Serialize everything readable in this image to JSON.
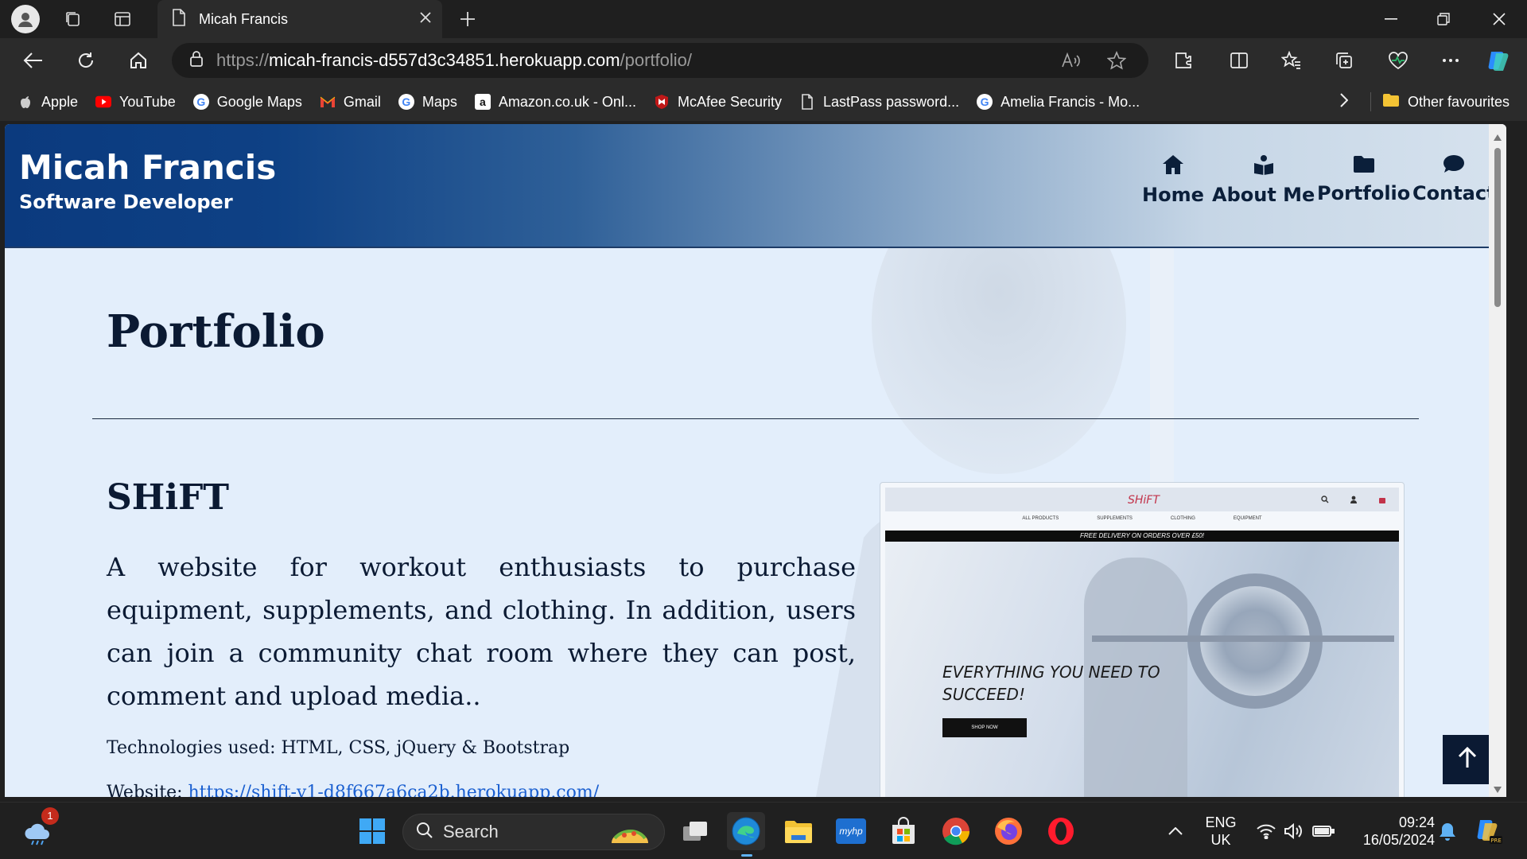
{
  "browser": {
    "tab_title": "Micah Francis",
    "url_prefix": "https://",
    "url_host": "micah-francis-d557d3c34851.herokuapp.com",
    "url_path": "/portfolio/",
    "bookmarks": [
      {
        "label": "Apple",
        "icon": "apple-icon"
      },
      {
        "label": "YouTube",
        "icon": "youtube-icon"
      },
      {
        "label": "Google Maps",
        "icon": "google-icon"
      },
      {
        "label": "Gmail",
        "icon": "gmail-icon"
      },
      {
        "label": "Maps",
        "icon": "google-icon"
      },
      {
        "label": "Amazon.co.uk - Onl...",
        "icon": "amazon-icon"
      },
      {
        "label": "McAfee Security",
        "icon": "mcafee-icon"
      },
      {
        "label": "LastPass password...",
        "icon": "page-icon"
      },
      {
        "label": "Amelia Francis - Mo...",
        "icon": "google-icon"
      }
    ],
    "other_favourites": "Other favourites"
  },
  "site": {
    "brand_name": "Micah Francis",
    "brand_role": "Software Developer",
    "nav": [
      {
        "label": "Home",
        "icon": "home-icon"
      },
      {
        "label": "About Me",
        "icon": "reader-icon"
      },
      {
        "label": "Portfolio",
        "icon": "folder-icon"
      },
      {
        "label": "Contact",
        "icon": "chat-icon"
      }
    ]
  },
  "main": {
    "section_title": "Portfolio",
    "project": {
      "title": "SHiFT",
      "description": "A website for workout enthusiasts to purchase equipment, supplements, and clothing. In addition, users can join a community chat room where they can post, comment and upload media..",
      "technologies": "Technologies used: HTML, CSS, jQuery & Bootstrap",
      "website_label": "Website: ",
      "website_url": "https://shift-v1-d8f667a6ca2b.herokuapp.com/",
      "preview": {
        "logo": "SHiFT",
        "menu": [
          "ALL PRODUCTS",
          "SUPPLEMENTS",
          "CLOTHING",
          "EQUIPMENT"
        ],
        "banner": "FREE DELIVERY ON ORDERS OVER £50!",
        "headline_line1": "EVERYTHING YOU NEED TO",
        "headline_line2": "SUCCEED!",
        "button": "SHOP NOW"
      }
    }
  },
  "taskbar": {
    "search_placeholder": "Search",
    "weather_badge": "1",
    "lang_line1": "ENG",
    "lang_line2": "UK",
    "time": "09:24",
    "date": "16/05/2024"
  },
  "colors": {
    "header_dark": "#0b3a7e",
    "text_dark": "#0b1a33",
    "link": "#1a5fd0"
  }
}
